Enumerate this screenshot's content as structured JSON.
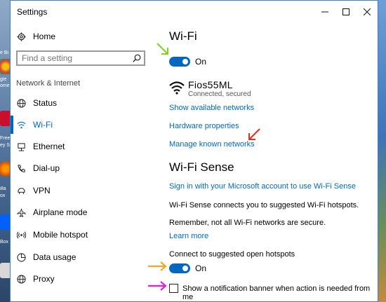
{
  "window": {
    "title": "Settings"
  },
  "sidebar": {
    "home_label": "Home",
    "search_placeholder": "Find a setting",
    "section_label": "Network & Internet",
    "items": [
      {
        "label": "Status",
        "icon": "globe-icon"
      },
      {
        "label": "Wi-Fi",
        "icon": "wifi-icon",
        "active": true
      },
      {
        "label": "Ethernet",
        "icon": "ethernet-icon"
      },
      {
        "label": "Dial-up",
        "icon": "phone-icon"
      },
      {
        "label": "VPN",
        "icon": "vpn-icon"
      },
      {
        "label": "Airplane mode",
        "icon": "airplane-icon"
      },
      {
        "label": "Mobile hotspot",
        "icon": "hotspot-icon"
      },
      {
        "label": "Data usage",
        "icon": "data-usage-icon"
      },
      {
        "label": "Proxy",
        "icon": "globe-icon"
      }
    ]
  },
  "main": {
    "wifi_heading": "Wi-Fi",
    "wifi_toggle_label": "On",
    "network_name": "Fios55ML",
    "network_status": "Connected, secured",
    "link_show_networks": "Show available networks",
    "link_hardware": "Hardware properties",
    "link_manage": "Manage known networks",
    "sense_heading": "Wi-Fi Sense",
    "link_signin": "Sign in with your Microsoft account to use Wi-Fi Sense",
    "sense_desc": "Wi-Fi Sense connects you to suggested Wi-Fi hotspots.",
    "sense_note": "Remember, not all Wi-Fi networks are secure.",
    "link_learn": "Learn more",
    "hotspots_label": "Connect to suggested open hotspots",
    "hotspots_toggle_label": "On",
    "notification_label": "Show a notification banner when action is needed from me"
  },
  "colors": {
    "accent": "#0067c0",
    "arrow_green": "#7ed321",
    "arrow_red": "#e0301e",
    "arrow_orange": "#f5a623",
    "arrow_magenta": "#e020e0"
  },
  "desktop": {
    "labels": [
      "e Bi",
      "gle",
      "ome",
      "Free",
      "ey Sc",
      "illa",
      "ox",
      "Box"
    ]
  }
}
